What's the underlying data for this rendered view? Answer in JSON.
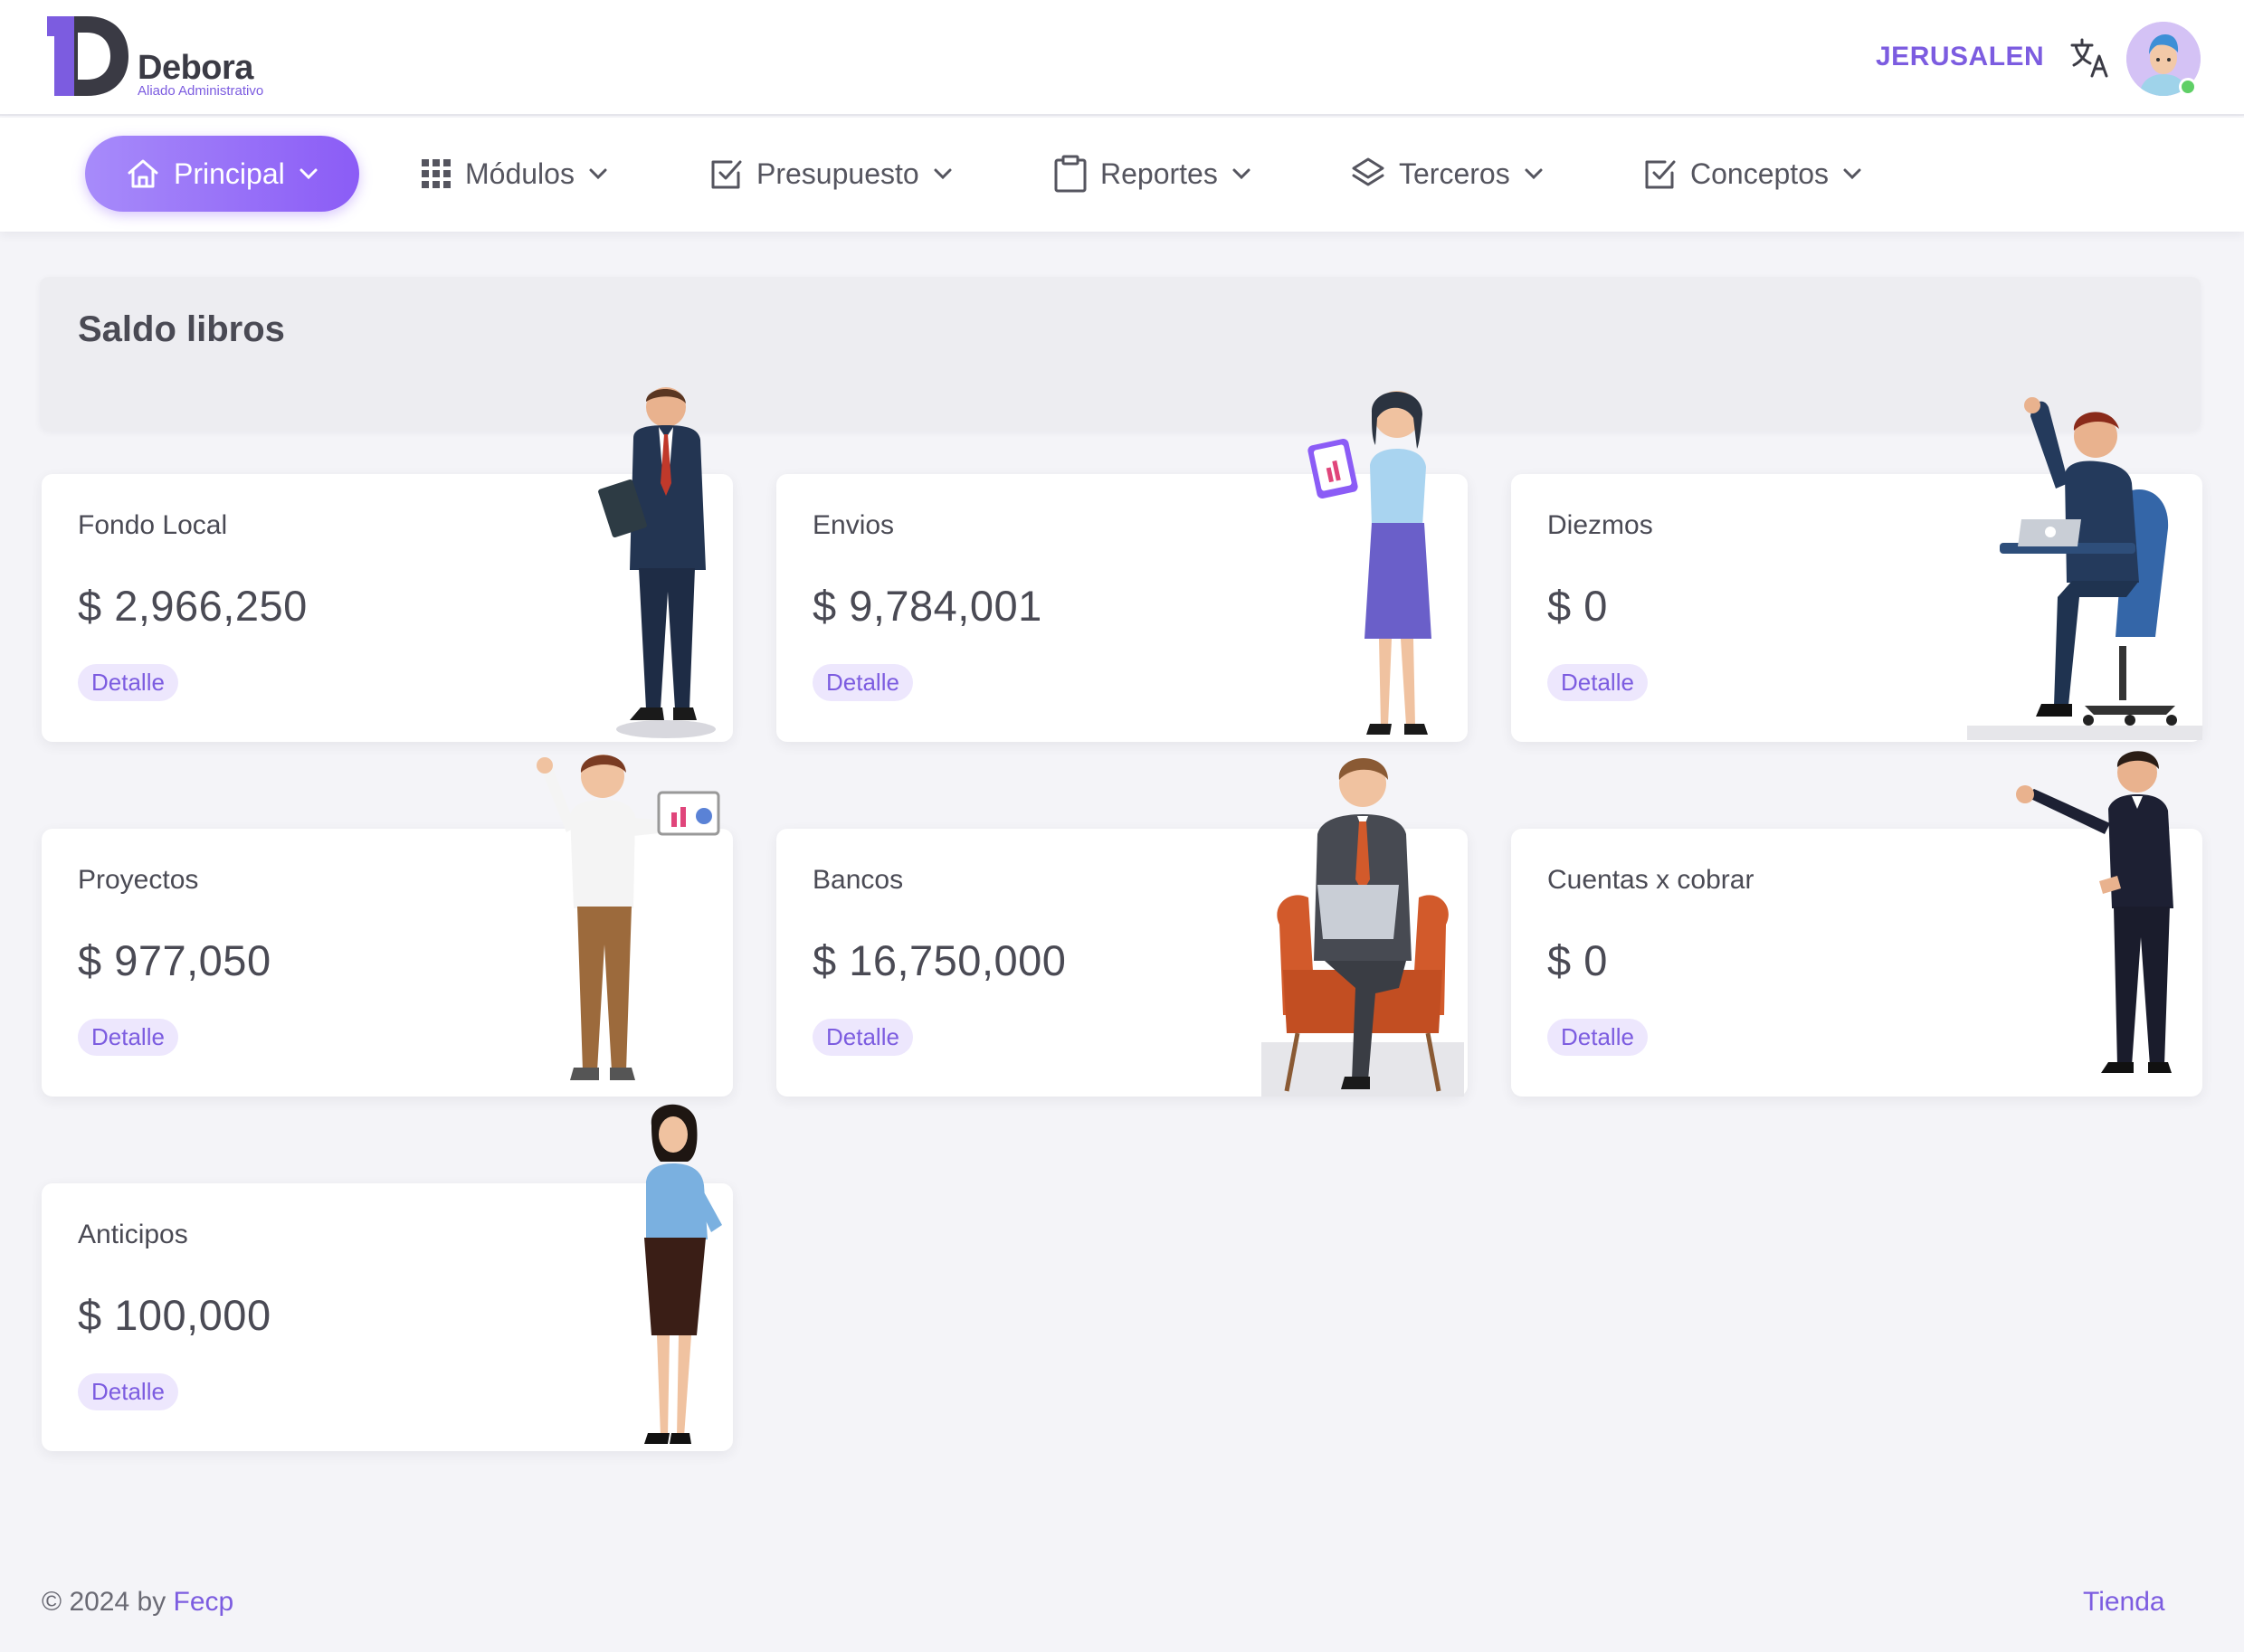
{
  "brand": {
    "name": "Debora",
    "tagline": "Aliado Administrativo"
  },
  "header": {
    "organization": "JERUSALEN",
    "translate_icon": "translate-icon",
    "avatar_icon": "user-avatar"
  },
  "nav": {
    "items": [
      {
        "label": "Principal",
        "icon": "home-icon",
        "active": true
      },
      {
        "label": "Módulos",
        "icon": "grid-icon"
      },
      {
        "label": "Presupuesto",
        "icon": "checkbox-icon"
      },
      {
        "label": "Reportes",
        "icon": "clipboard-icon"
      },
      {
        "label": "Terceros",
        "icon": "layers-icon"
      },
      {
        "label": "Conceptos",
        "icon": "checkbox-icon"
      }
    ]
  },
  "section": {
    "title": "Saldo libros"
  },
  "cards": [
    {
      "title": "Fondo Local",
      "value": "$ 2,966,250",
      "button": "Detalle"
    },
    {
      "title": "Envios",
      "value": "$ 9,784,001",
      "button": "Detalle"
    },
    {
      "title": "Diezmos",
      "value": "$ 0",
      "button": "Detalle"
    },
    {
      "title": "Proyectos",
      "value": "$ 977,050",
      "button": "Detalle"
    },
    {
      "title": "Bancos",
      "value": "$ 16,750,000",
      "button": "Detalle"
    },
    {
      "title": "Cuentas x cobrar",
      "value": "$ 0",
      "button": "Detalle"
    },
    {
      "title": "Anticipos",
      "value": "$ 100,000",
      "button": "Detalle"
    }
  ],
  "footer": {
    "copyright": "© 2024 by ",
    "author": "Fecp",
    "link": "Tienda"
  },
  "colors": {
    "accent": "#8b5cf6",
    "accent_text": "#7c5ce0",
    "background": "#f4f4f8"
  }
}
